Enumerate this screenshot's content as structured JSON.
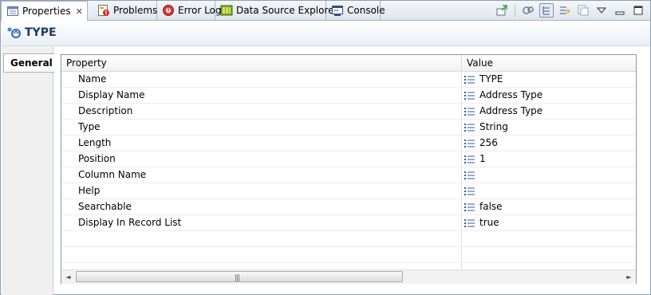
{
  "tabs": [
    {
      "label": "Properties",
      "icon": "properties-icon",
      "active": true,
      "close": "✕"
    },
    {
      "label": "Problems",
      "icon": "problems-icon"
    },
    {
      "label": "Error Log",
      "icon": "error-log-icon"
    },
    {
      "label": "Data Source Explorer",
      "icon": "data-source-explorer-icon"
    },
    {
      "label": "Console",
      "icon": "console-icon"
    }
  ],
  "toolbar": {
    "icons": [
      "pin-icon",
      "filter-advanced-icon",
      "show-categories-icon",
      "restore-default-icon",
      "copy-icon",
      "view-menu-icon",
      "minimize-icon",
      "maximize-icon"
    ]
  },
  "title": {
    "text": "TYPE",
    "icon": "attribute-icon"
  },
  "side_tabs": [
    {
      "label": "General",
      "selected": true
    }
  ],
  "table": {
    "headers": {
      "property": "Property",
      "value": "Value"
    },
    "rows": [
      {
        "property": "Name",
        "value": "TYPE"
      },
      {
        "property": "Display Name",
        "value": "Address Type"
      },
      {
        "property": "Description",
        "value": "Address Type"
      },
      {
        "property": "Type",
        "value": "String"
      },
      {
        "property": "Length",
        "value": "256"
      },
      {
        "property": "Position",
        "value": "1"
      },
      {
        "property": "Column Name",
        "value": ""
      },
      {
        "property": "Help",
        "value": ""
      },
      {
        "property": "Searchable",
        "value": "false"
      },
      {
        "property": "Display In Record List",
        "value": "true"
      }
    ],
    "value_icon": "list-value-icon"
  },
  "scrollbar": {
    "left_arrow": "◄",
    "right_arrow": "►",
    "grip": "|||"
  },
  "colors": {
    "title_text": "#1e3a66",
    "border": "#8e9fb4"
  }
}
